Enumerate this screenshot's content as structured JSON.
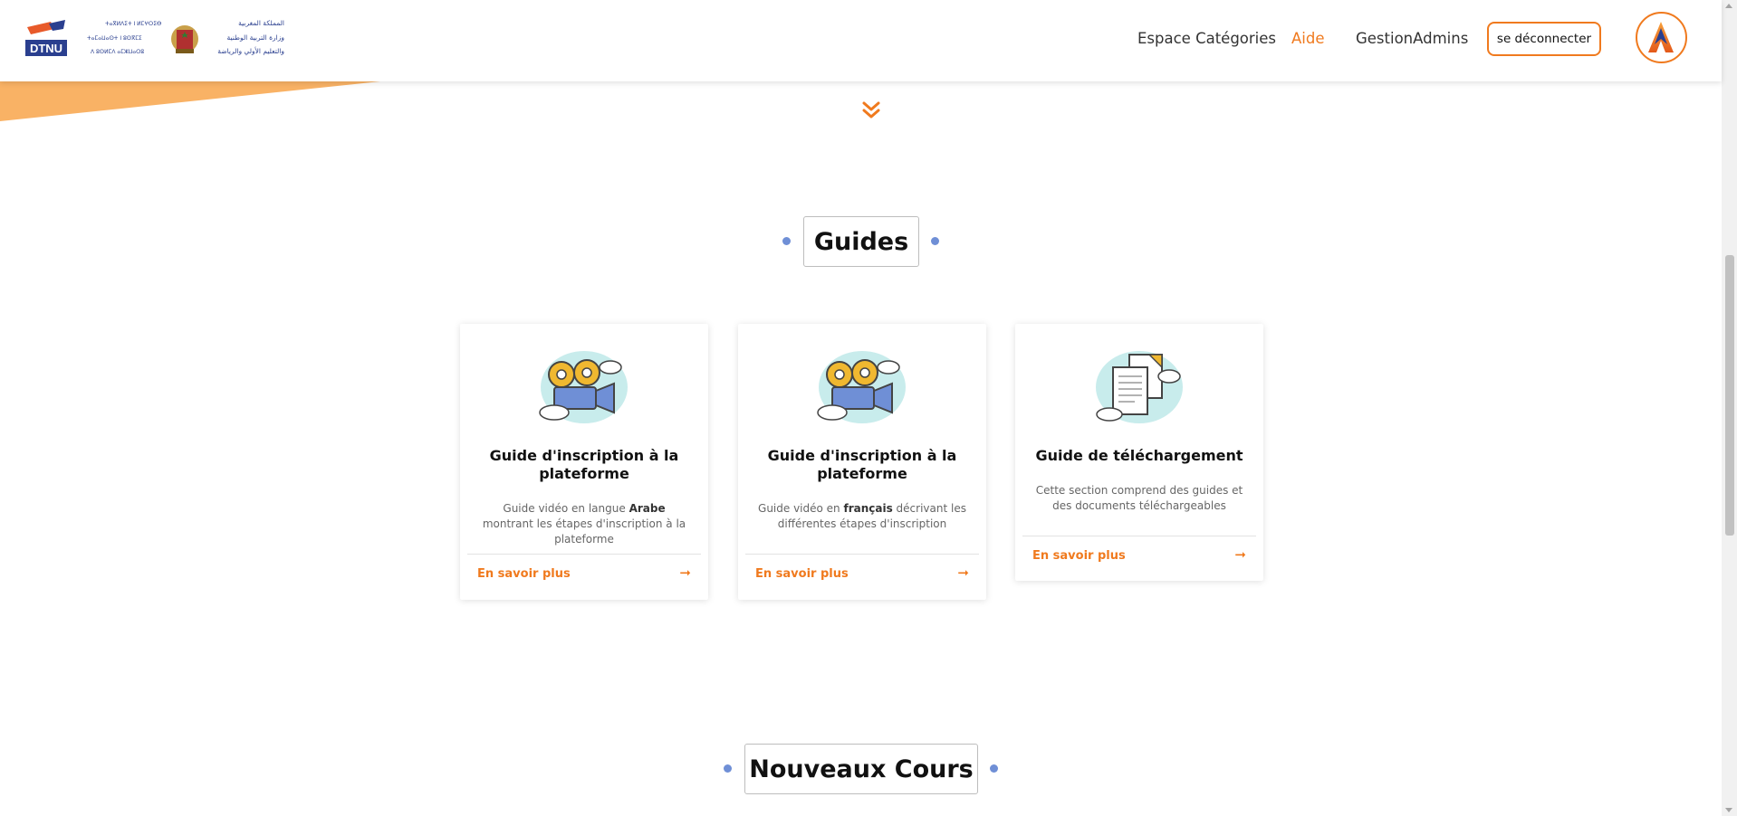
{
  "header": {
    "logo_left_text": "DTNU",
    "logo_arabic_lines": [
      "المملكة المغربية",
      "وزارة التربية الوطنية",
      "والتعليم الأولي والرياضة"
    ],
    "logo_tifinagh_lines": [
      "ⵜⴰⴳⵍⴷⵉⵜ ⵏ ⵍⵎⵖⵔⵉⴱ",
      "ⵜⴰⵎⴰⵡⴰⵙⵜ ⵏ ⵓⵙⴳⵎⵉ ⴰⵏⴰⵎⵓⵔ",
      "ⴷ ⵓⵙⵍⵎⴷ ⴰⵎⵣⵡⴰⵔⵓ ⴷ ⵜⵏⴰⴷⴰⵏⵜ"
    ],
    "nav": [
      {
        "label": "Espace Catégories",
        "active": false
      },
      {
        "label": "Aide",
        "active": true
      },
      {
        "label": "GestionAdmins",
        "active": false
      }
    ],
    "logout_label": "se déconnecter"
  },
  "colors": {
    "accent": "#f07a1e",
    "dot": "#6f8fd6"
  },
  "guides": {
    "title": "Guides",
    "cards": [
      {
        "icon": "video-camera-icon",
        "title": "Guide d'inscription à la plateforme",
        "desc_before": "Guide vidéo en langue ",
        "desc_bold": "Arabe",
        "desc_after": " montrant les étapes d'inscription à la plateforme",
        "link": "En savoir plus"
      },
      {
        "icon": "video-camera-icon",
        "title": "Guide d'inscription à la plateforme",
        "desc_before": "Guide vidéo en ",
        "desc_bold": "français",
        "desc_after": " décrivant les différentes étapes d'inscription",
        "link": "En savoir plus"
      },
      {
        "icon": "documents-icon",
        "title": "Guide de téléchargement",
        "desc_before": "Cette section comprend des guides et des documents téléchargeables",
        "desc_bold": "",
        "desc_after": "",
        "link": "En savoir plus"
      }
    ]
  },
  "new_courses": {
    "title": "Nouveaux Cours"
  }
}
